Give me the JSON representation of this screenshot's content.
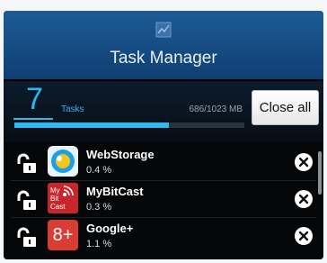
{
  "header": {
    "title": "Task Manager",
    "icon": "chart-icon"
  },
  "stats": {
    "task_count": "7",
    "tasks_label": "Tasks",
    "memory": "686/1023 MB",
    "memory_used_fraction": 0.67,
    "close_all_label": "Close all"
  },
  "apps": [
    {
      "name": "WebStorage",
      "percent": "0.4 %",
      "icon": "webstorage-icon"
    },
    {
      "name": "MyBitCast",
      "percent": "0.3 %",
      "icon": "mybitcast-icon",
      "icon_text": [
        "My",
        "Bit",
        "Cast"
      ]
    },
    {
      "name": "Google+",
      "percent": "1.1 %",
      "icon": "google-plus-icon",
      "icon_text": "8+"
    }
  ],
  "colors": {
    "accent": "#2fb5f0",
    "header": "#1d5c95",
    "background": "#050608"
  }
}
